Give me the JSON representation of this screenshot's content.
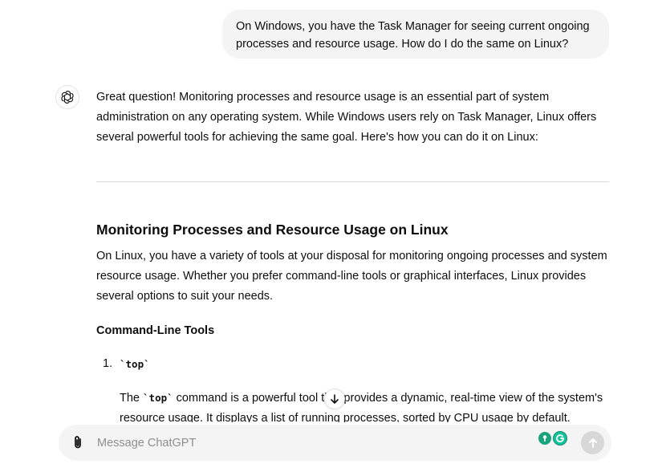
{
  "conversation": {
    "user_message": "On Windows, you have the Task Manager for seeing current ongoing processes and resource usage. How do I do the same on Linux?",
    "assistant": {
      "intro": "Great question! Monitoring processes and resource usage is an essential part of system administration on any operating system. While Windows users rely on Task Manager, Linux offers several powerful tools for achieving the same goal. Here's how you can do it on Linux:",
      "heading": "Monitoring Processes and Resource Usage on Linux",
      "paragraph": "On Linux, you have a variety of tools at your disposal for monitoring ongoing processes and system resource usage. Whether you prefer command-line tools or graphical interfaces, Linux provides several options to suit your needs.",
      "subheading": "Command-Line Tools",
      "list_item_number": "1.",
      "list_item_title": "`top`",
      "list_item_desc_before": "The ",
      "list_item_desc_code": "`top`",
      "list_item_desc_after": " command is a powerful tool that provides a dynamic, real-time view of the system's resource usage. It displays a list of running processes, sorted by CPU usage by default."
    }
  },
  "composer": {
    "placeholder": "Message ChatGPT"
  },
  "icons": {
    "avatar": "openai-logo-icon",
    "scroll": "arrow-down-icon",
    "attach": "paperclip-icon",
    "extension_1": "extension-icon",
    "extension_2": "grammarly-icon",
    "send": "arrow-up-icon"
  },
  "colors": {
    "user_bubble": "#f4f4f4",
    "composer_bg": "#f4f4f4",
    "send_button_disabled": "#d7d7d7",
    "grammarly_green": "#15c39a"
  }
}
